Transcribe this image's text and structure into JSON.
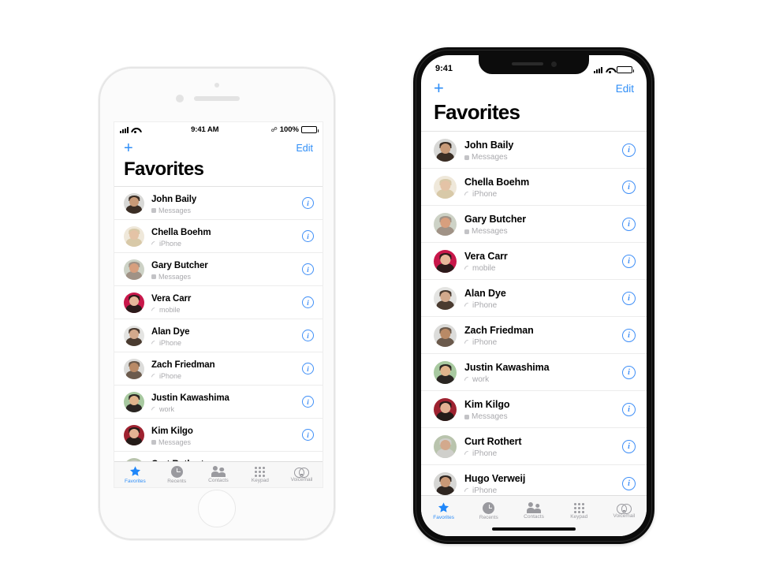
{
  "phones": {
    "iphone8": {
      "name": "iphone-8-white",
      "status_bar": {
        "time": "9:41 AM",
        "battery_percent": "100%",
        "bluetooth_icon": "bluetooth-icon",
        "signal_icon": "cellular-bars-icon",
        "wifi_icon": "wifi-icon",
        "battery_icon": "battery-icon"
      },
      "nav": {
        "add_label": "+",
        "edit_label": "Edit"
      },
      "title": "Favorites"
    },
    "iphonex": {
      "name": "iphone-x-black",
      "status_bar": {
        "time": "9:41",
        "signal_icon": "cellular-bars-icon",
        "wifi_icon": "wifi-icon",
        "battery_icon": "battery-icon"
      },
      "nav": {
        "add_label": "+",
        "edit_label": "Edit"
      },
      "title": "Favorites"
    }
  },
  "contacts": [
    {
      "name": "John Baily",
      "label": "Messages",
      "type": "messages",
      "avatar_bg": "#d8d8d6",
      "hair": "#3a2d24",
      "skin": "#c89a78",
      "info": "info-button"
    },
    {
      "name": "Chella Boehm",
      "label": "iPhone",
      "type": "phone",
      "avatar_bg": "#efe8da",
      "hair": "#d8c9a8",
      "skin": "#e4c3a6",
      "info": "info-button"
    },
    {
      "name": "Gary Butcher",
      "label": "Messages",
      "type": "messages",
      "avatar_bg": "#cdd2c6",
      "hair": "#a09286",
      "skin": "#d79f7e",
      "info": "info-button"
    },
    {
      "name": "Vera Carr",
      "label": "mobile",
      "type": "phone",
      "avatar_bg": "#c8174a",
      "hair": "#2b1a1a",
      "skin": "#e6b79a",
      "info": "info-button"
    },
    {
      "name": "Alan Dye",
      "label": "iPhone",
      "type": "phone",
      "avatar_bg": "#e4e4e2",
      "hair": "#4a3b30",
      "skin": "#d2a98c",
      "info": "info-button"
    },
    {
      "name": "Zach Friedman",
      "label": "iPhone",
      "type": "phone",
      "avatar_bg": "#dcdcda",
      "hair": "#6b5a4c",
      "skin": "#b98a66",
      "info": "info-button"
    },
    {
      "name": "Justin Kawashima",
      "label": "work",
      "type": "phone",
      "avatar_bg": "#a8c9a0",
      "hair": "#2a2522",
      "skin": "#e0b48c",
      "info": "info-button"
    },
    {
      "name": "Kim Kilgo",
      "label": "Messages",
      "type": "messages",
      "avatar_bg": "#9e2230",
      "hair": "#241b18",
      "skin": "#e2b293",
      "info": "info-button"
    },
    {
      "name": "Curt Rothert",
      "label": "iPhone",
      "type": "phone",
      "avatar_bg": "#b9c4ad",
      "hair": "#cfcfcb",
      "skin": "#d3a98d",
      "info": "info-button"
    },
    {
      "name": "Hugo Verweij",
      "label": "iPhone",
      "type": "phone",
      "avatar_bg": "#d6d6d4",
      "hair": "#2e2520",
      "skin": "#c99876",
      "info": "info-button"
    }
  ],
  "tabs": [
    {
      "label": "Favorites",
      "icon": "star-icon",
      "active": true
    },
    {
      "label": "Recents",
      "icon": "clock-icon",
      "active": false
    },
    {
      "label": "Contacts",
      "icon": "people-icon",
      "active": false
    },
    {
      "label": "Keypad",
      "icon": "keypad-icon",
      "active": false
    },
    {
      "label": "Voicemail",
      "icon": "voicemail-icon",
      "active": false
    }
  ],
  "colors": {
    "accent": "#2f8ef7",
    "star_active": "#1f86f9",
    "tab_inactive": "#9a9a9f",
    "subtitle": "#a9a9ad"
  }
}
